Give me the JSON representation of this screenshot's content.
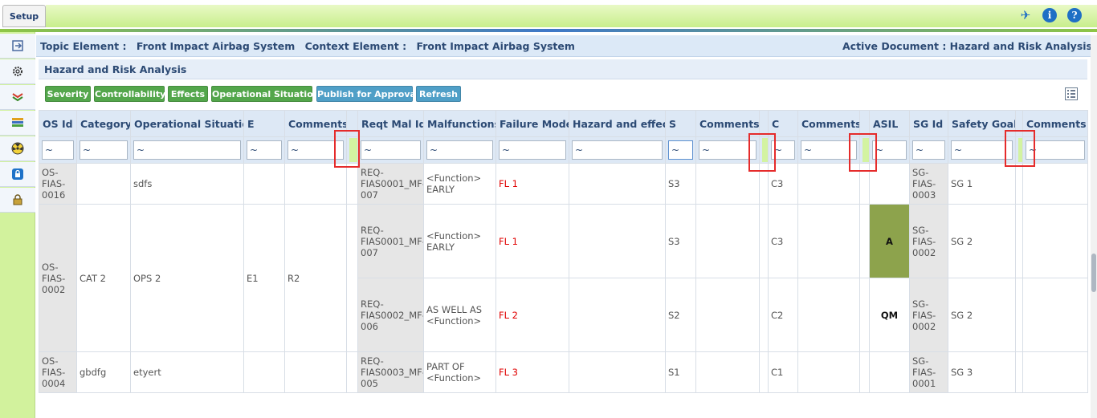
{
  "topbar": {
    "tab_label": "Setup",
    "icons": [
      "pin-icon",
      "info-icon",
      "help-icon"
    ]
  },
  "left_rail": {
    "icons": [
      "exit-icon",
      "gear-icon",
      "layers-icon",
      "stack-icon",
      "hazard-icon",
      "lock-icon",
      "padlock-icon"
    ]
  },
  "context": {
    "topic_label": "Topic Element :",
    "topic_value": "Front Impact Airbag System",
    "context_label": "Context Element :",
    "context_value": "Front Impact Airbag System",
    "active_doc": "Active Document : Hazard and Risk Analysis"
  },
  "panel": {
    "title": "Hazard and Risk Analysis"
  },
  "toolbar": {
    "severity": "Severity",
    "controllability": "Controllability",
    "effects": "Effects",
    "operational_situation": "Operational Situation",
    "publish": "Publish for Approval",
    "refresh": "Refresh"
  },
  "columns": [
    "OS Id",
    "Category",
    "Operational Situation",
    "E",
    "Comments",
    "",
    "Reqt Mal Id",
    "Malfunctions",
    "Failure Mode",
    "Hazard and effect",
    "S",
    "Comments",
    "",
    "C",
    "Comments",
    "",
    "ASIL",
    "SG Id",
    "Safety Goal",
    "",
    "Comments"
  ],
  "filter_value": "~",
  "rows": {
    "r1": {
      "os_id": "OS-\nFIAS-\n0016",
      "category": "",
      "op_sit": "sdfs",
      "e": "",
      "comments": "",
      "reqt": "REQ-\nFIAS0001_MF-\n007",
      "malf": "<Function>\nEARLY",
      "fm": "FL 1",
      "hazard": "",
      "s": "S3",
      "s_comments": "",
      "c": "C3",
      "c_comments": "",
      "asil": "",
      "sg_id": "SG-\nFIAS-\n0003",
      "sg": "SG 1",
      "comments2": ""
    },
    "r2": {
      "os_id": "OS-\nFIAS-\n0002",
      "category": "CAT 2",
      "op_sit": "OPS 2",
      "e": "E1",
      "comments": "R2",
      "reqt": "REQ-\nFIAS0001_MF-\n007",
      "malf": "<Function>\nEARLY",
      "fm": "FL 1",
      "hazard": "",
      "s": "S3",
      "s_comments": "",
      "c": "C3",
      "c_comments": "",
      "asil": "A",
      "sg_id": "SG-\nFIAS-\n0002",
      "sg": "SG 2",
      "comments2": ""
    },
    "r3": {
      "reqt": "REQ-\nFIAS0002_MF-\n006",
      "malf": "AS WELL AS\n<Function>",
      "fm": "FL 2",
      "hazard": "",
      "s": "S2",
      "s_comments": "",
      "c": "C2",
      "c_comments": "",
      "asil": "QM",
      "sg_id": "SG-\nFIAS-\n0002",
      "sg": "SG 2",
      "comments2": ""
    },
    "r4": {
      "os_id": "OS-\nFIAS-\n0004",
      "category": "gbdfg",
      "op_sit": "etyert",
      "e": "",
      "comments": "",
      "reqt": "REQ-\nFIAS0003_MF-\n005",
      "malf": "PART OF\n<Function>",
      "fm": "FL 3",
      "hazard": "",
      "s": "S1",
      "s_comments": "",
      "c": "C1",
      "c_comments": "",
      "asil": "",
      "sg_id": "SG-\nFIAS-\n0001",
      "sg": "SG 3",
      "comments2": ""
    }
  },
  "colors": {
    "asil_a": "#8da34c",
    "failure_mode": "#e00000",
    "highlight_box": "#e52b2b"
  }
}
